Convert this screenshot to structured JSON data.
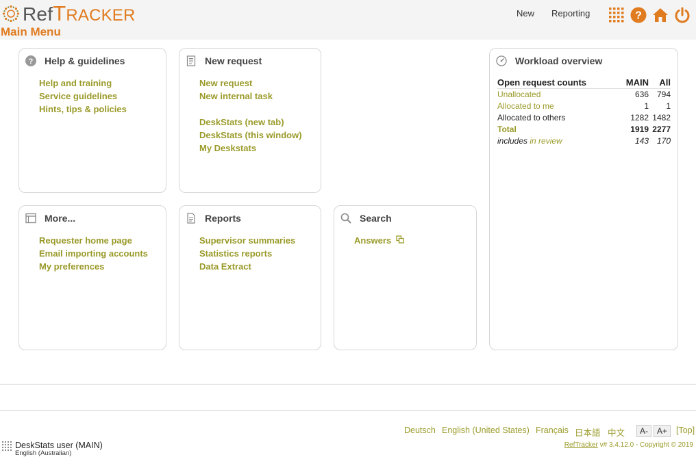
{
  "app": {
    "logo_ref": "Ref",
    "logo_t": "T",
    "logo_rest": "RACKER",
    "page_title": "Main Menu"
  },
  "topnav": {
    "new": "New",
    "reporting": "Reporting",
    "icons": [
      "grid-icon",
      "help-icon",
      "home-icon",
      "power-icon"
    ]
  },
  "panels": {
    "help": {
      "title": "Help & guidelines",
      "links": [
        "Help and training",
        "Service guidelines",
        "Hints, tips & policies"
      ]
    },
    "new_request": {
      "title": "New request",
      "links": [
        "New request",
        "New internal task",
        "DeskStats (new tab)",
        "DeskStats (this window)",
        "My Deskstats"
      ]
    },
    "more": {
      "title": "More...",
      "links": [
        "Requester home page",
        "Email importing accounts",
        "My preferences"
      ]
    },
    "reports": {
      "title": "Reports",
      "links": [
        "Supervisor summaries",
        "Statistics reports",
        "Data Extract"
      ]
    },
    "search": {
      "title": "Search",
      "links": [
        "Answers"
      ]
    },
    "workload": {
      "title": "Workload overview",
      "table": {
        "header": [
          "Open request counts",
          "MAIN",
          "All"
        ],
        "rows": [
          {
            "label": "Unallocated",
            "main": "636",
            "all": "794"
          },
          {
            "label": "Allocated to me",
            "main": "1",
            "all": "1"
          },
          {
            "label": "Allocated to others",
            "main": "1282",
            "all": "1482"
          },
          {
            "label": "Total",
            "main": "1919",
            "all": "2277"
          }
        ],
        "review": {
          "prefix": "includes",
          "link": "in review",
          "main": "143",
          "all": "170"
        }
      }
    }
  },
  "footer": {
    "languages": [
      "Deutsch",
      "English (United States)",
      "Français",
      "日本語",
      "中文"
    ],
    "font_smaller": "A-",
    "font_larger": "A+",
    "top": "[Top]",
    "user": "DeskStats user (MAIN)",
    "user_lang": "English (Australian)",
    "version_link": "RefTracker",
    "version_text": " v# 3.4.12.0 - Copyright © 2019"
  },
  "colors": {
    "accent": "#e07b20",
    "link": "#9a9a2a",
    "header_bg": "#f4f4f4"
  }
}
